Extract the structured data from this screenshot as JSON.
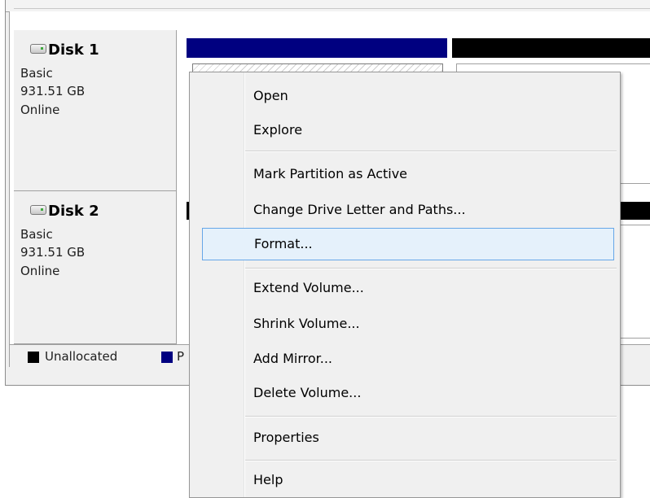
{
  "disks": [
    {
      "name": "Disk 1",
      "type": "Basic",
      "size": "931.51 GB",
      "status": "Online"
    },
    {
      "name": "Disk 2",
      "type": "Basic",
      "size": "931.51 GB",
      "status": "Online"
    }
  ],
  "legend": {
    "unallocated": "Unallocated",
    "primary_partial": "P",
    "unallocated_color": "#000000",
    "primary_color": "#000080"
  },
  "context_menu": {
    "open": "Open",
    "explore": "Explore",
    "mark_active": "Mark Partition as Active",
    "change_letter": "Change Drive Letter and Paths...",
    "format": "Format...",
    "extend": "Extend Volume...",
    "shrink": "Shrink Volume...",
    "add_mirror": "Add Mirror...",
    "delete": "Delete Volume...",
    "properties": "Properties",
    "help": "Help",
    "highlighted_item": "Format..."
  }
}
